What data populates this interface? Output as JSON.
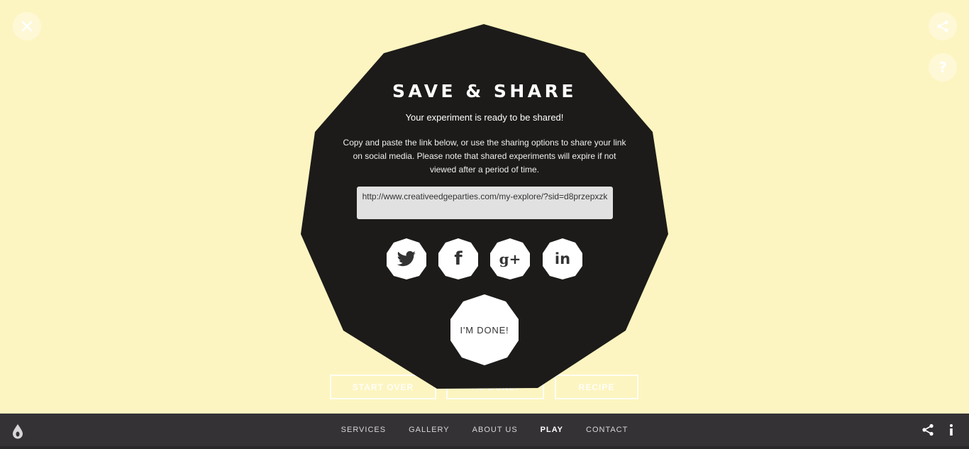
{
  "corner": {
    "close_icon": "close-icon",
    "share_icon": "share-icon",
    "help_label": "?"
  },
  "background_buttons": {
    "start_over": "START OVER",
    "middle": "I'M DONE!",
    "recipe": "RECIPE"
  },
  "modal": {
    "title": "SAVE & SHARE",
    "subtitle": "Your experiment is ready to be shared!",
    "description": "Copy and paste the link below, or use the sharing options to share your link on social media. Please note that shared experiments will expire if not viewed after a period of time.",
    "share_url": "http://www.creativeedgeparties.com/my-explore/?sid=d8przepxzk",
    "social": {
      "twitter_icon": "twitter-icon",
      "facebook_label": "f",
      "gplus_label": "g+",
      "linkedin_label": "in"
    },
    "done_label": "I'M DONE!"
  },
  "nav": {
    "items": [
      {
        "label": "SERVICES"
      },
      {
        "label": "GALLERY"
      },
      {
        "label": "ABOUT US"
      },
      {
        "label": "PLAY",
        "active": true
      },
      {
        "label": "CONTACT"
      }
    ]
  },
  "colors": {
    "background": "#fdf5c1",
    "overlay": "#1c1b19",
    "bottom_bar": "#353236",
    "link_box": "#e1e1e1"
  }
}
